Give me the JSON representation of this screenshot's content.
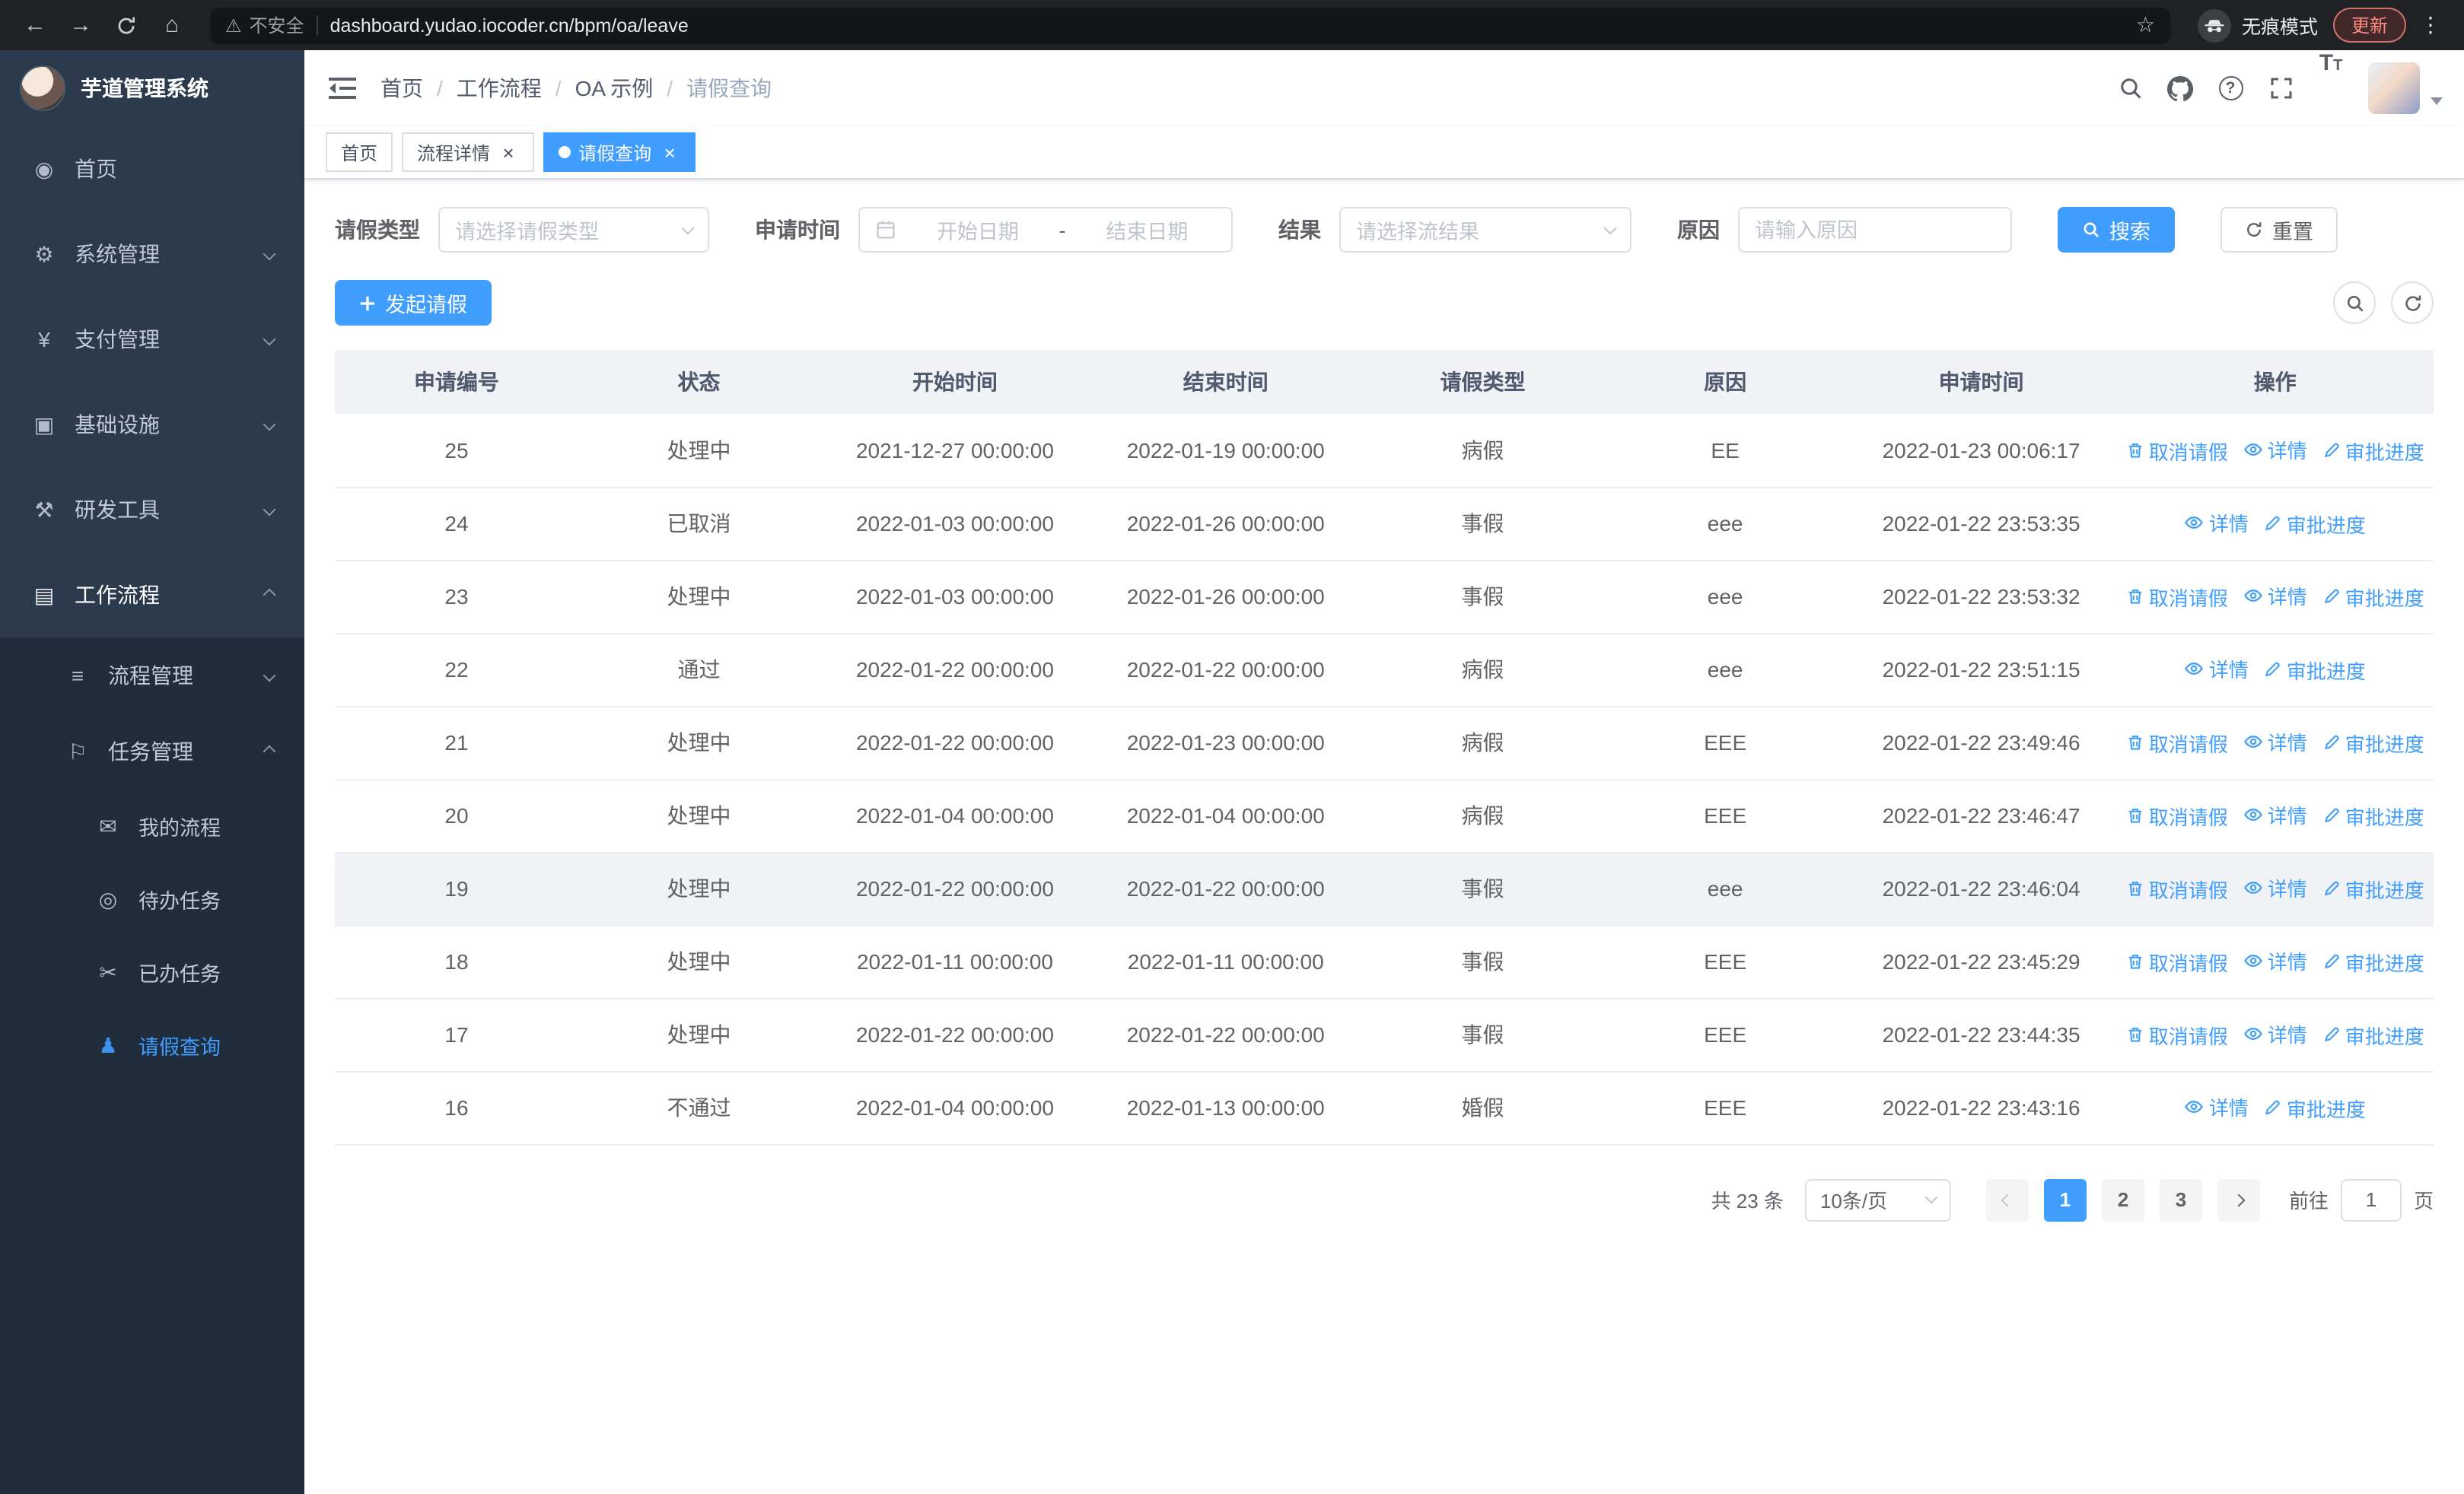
{
  "browser": {
    "security_label": "不安全",
    "url": "dashboard.yudao.iocoder.cn/bpm/oa/leave",
    "incognito_label": "无痕模式",
    "update_label": "更新"
  },
  "icons": {
    "dashboard-icon": "◉",
    "gear-icon": "⚙",
    "yen-icon": "¥",
    "monitor-icon": "▣",
    "tools-icon": "⚒",
    "briefcase-icon": "▤",
    "list-icon": "≡",
    "flag-icon": "⚐",
    "chat-icon": "✉",
    "eye-icon": "◎",
    "scissors-icon": "✂",
    "user-icon": "♟"
  },
  "sidebar": {
    "logo_title": "芋道管理系统",
    "menu": [
      {
        "key": "home",
        "label": "首页",
        "icon": "dashboard-icon",
        "level": 1,
        "expandable": false
      },
      {
        "key": "system",
        "label": "系统管理",
        "icon": "gear-icon",
        "level": 1,
        "expandable": true
      },
      {
        "key": "payment",
        "label": "支付管理",
        "icon": "yen-icon",
        "level": 1,
        "expandable": true
      },
      {
        "key": "infra",
        "label": "基础设施",
        "icon": "monitor-icon",
        "level": 1,
        "expandable": true
      },
      {
        "key": "devtools",
        "label": "研发工具",
        "icon": "tools-icon",
        "level": 1,
        "expandable": true
      },
      {
        "key": "workflow",
        "label": "工作流程",
        "icon": "briefcase-icon",
        "level": 1,
        "expandable": true,
        "expanded": true
      },
      {
        "key": "process-mgmt",
        "label": "流程管理",
        "icon": "list-icon",
        "level": 2,
        "expandable": true
      },
      {
        "key": "task-mgmt",
        "label": "任务管理",
        "icon": "flag-icon",
        "level": 2,
        "expandable": true,
        "expanded": true
      },
      {
        "key": "my-process",
        "label": "我的流程",
        "icon": "chat-icon",
        "level": 3
      },
      {
        "key": "todo-tasks",
        "label": "待办任务",
        "icon": "eye-icon",
        "level": 3
      },
      {
        "key": "done-tasks",
        "label": "已办任务",
        "icon": "scissors-icon",
        "level": 3
      },
      {
        "key": "leave-query",
        "label": "请假查询",
        "icon": "user-icon",
        "level": 3,
        "active": true
      }
    ]
  },
  "header": {
    "breadcrumb": [
      "首页",
      "工作流程",
      "OA 示例",
      "请假查询"
    ]
  },
  "tabs": [
    {
      "label": "首页",
      "active": false,
      "closable": false,
      "dot": false
    },
    {
      "label": "流程详情",
      "active": false,
      "closable": true,
      "dot": false
    },
    {
      "label": "请假查询",
      "active": true,
      "closable": true,
      "dot": true
    }
  ],
  "filters": {
    "leave_type_label": "请假类型",
    "leave_type_placeholder": "请选择请假类型",
    "apply_time_label": "申请时间",
    "start_date_placeholder": "开始日期",
    "range_separator": "-",
    "end_date_placeholder": "结束日期",
    "result_label": "结果",
    "result_placeholder": "请选择流结果",
    "reason_label": "原因",
    "reason_placeholder": "请输入原因",
    "search_label": "搜索",
    "reset_label": "重置"
  },
  "toolbar": {
    "create_label": "发起请假"
  },
  "table": {
    "columns": [
      "申请编号",
      "状态",
      "开始时间",
      "结束时间",
      "请假类型",
      "原因",
      "申请时间",
      "操作"
    ],
    "action_labels": {
      "cancel": "取消请假",
      "detail": "详情",
      "progress": "审批进度"
    },
    "action_icons": {
      "cancel": "trash-icon",
      "detail": "view-icon",
      "progress": "edit-icon"
    },
    "rows": [
      {
        "id": "25",
        "status": "处理中",
        "start": "2021-12-27 00:00:00",
        "end": "2022-01-19 00:00:00",
        "type": "病假",
        "reason": "EE",
        "applied": "2022-01-23 00:06:17",
        "actions": [
          "cancel",
          "detail",
          "progress"
        ]
      },
      {
        "id": "24",
        "status": "已取消",
        "start": "2022-01-03 00:00:00",
        "end": "2022-01-26 00:00:00",
        "type": "事假",
        "reason": "eee",
        "applied": "2022-01-22 23:53:35",
        "actions": [
          "detail",
          "progress"
        ]
      },
      {
        "id": "23",
        "status": "处理中",
        "start": "2022-01-03 00:00:00",
        "end": "2022-01-26 00:00:00",
        "type": "事假",
        "reason": "eee",
        "applied": "2022-01-22 23:53:32",
        "actions": [
          "cancel",
          "detail",
          "progress"
        ]
      },
      {
        "id": "22",
        "status": "通过",
        "start": "2022-01-22 00:00:00",
        "end": "2022-01-22 00:00:00",
        "type": "病假",
        "reason": "eee",
        "applied": "2022-01-22 23:51:15",
        "actions": [
          "detail",
          "progress"
        ]
      },
      {
        "id": "21",
        "status": "处理中",
        "start": "2022-01-22 00:00:00",
        "end": "2022-01-23 00:00:00",
        "type": "病假",
        "reason": "EEE",
        "applied": "2022-01-22 23:49:46",
        "actions": [
          "cancel",
          "detail",
          "progress"
        ]
      },
      {
        "id": "20",
        "status": "处理中",
        "start": "2022-01-04 00:00:00",
        "end": "2022-01-04 00:00:00",
        "type": "病假",
        "reason": "EEE",
        "applied": "2022-01-22 23:46:47",
        "actions": [
          "cancel",
          "detail",
          "progress"
        ]
      },
      {
        "id": "19",
        "status": "处理中",
        "start": "2022-01-22 00:00:00",
        "end": "2022-01-22 00:00:00",
        "type": "事假",
        "reason": "eee",
        "applied": "2022-01-22 23:46:04",
        "actions": [
          "cancel",
          "detail",
          "progress"
        ],
        "hovered": true
      },
      {
        "id": "18",
        "status": "处理中",
        "start": "2022-01-11 00:00:00",
        "end": "2022-01-11 00:00:00",
        "type": "事假",
        "reason": "EEE",
        "applied": "2022-01-22 23:45:29",
        "actions": [
          "cancel",
          "detail",
          "progress"
        ]
      },
      {
        "id": "17",
        "status": "处理中",
        "start": "2022-01-22 00:00:00",
        "end": "2022-01-22 00:00:00",
        "type": "事假",
        "reason": "EEE",
        "applied": "2022-01-22 23:44:35",
        "actions": [
          "cancel",
          "detail",
          "progress"
        ]
      },
      {
        "id": "16",
        "status": "不通过",
        "start": "2022-01-04 00:00:00",
        "end": "2022-01-13 00:00:00",
        "type": "婚假",
        "reason": "EEE",
        "applied": "2022-01-22 23:43:16",
        "actions": [
          "detail",
          "progress"
        ]
      }
    ]
  },
  "pagination": {
    "total_text": "共 23 条",
    "page_size": "10条/页",
    "pages": [
      "1",
      "2",
      "3"
    ],
    "active_page": "1",
    "prev_disabled": true,
    "goto_label": "前往",
    "goto_value": "1",
    "page_unit_label": "页"
  },
  "colors": {
    "primary": "#409eff",
    "sidebar_bg": "#2b3a4d",
    "submenu_bg": "#1f2d3d"
  }
}
